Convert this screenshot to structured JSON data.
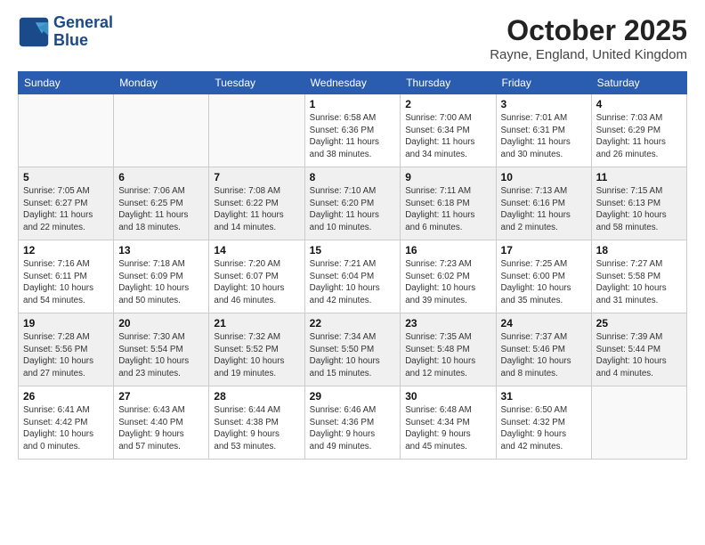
{
  "header": {
    "logo_line1": "General",
    "logo_line2": "Blue",
    "month": "October 2025",
    "location": "Rayne, England, United Kingdom"
  },
  "weekdays": [
    "Sunday",
    "Monday",
    "Tuesday",
    "Wednesday",
    "Thursday",
    "Friday",
    "Saturday"
  ],
  "weeks": [
    [
      {
        "day": "",
        "info": ""
      },
      {
        "day": "",
        "info": ""
      },
      {
        "day": "",
        "info": ""
      },
      {
        "day": "1",
        "info": "Sunrise: 6:58 AM\nSunset: 6:36 PM\nDaylight: 11 hours\nand 38 minutes."
      },
      {
        "day": "2",
        "info": "Sunrise: 7:00 AM\nSunset: 6:34 PM\nDaylight: 11 hours\nand 34 minutes."
      },
      {
        "day": "3",
        "info": "Sunrise: 7:01 AM\nSunset: 6:31 PM\nDaylight: 11 hours\nand 30 minutes."
      },
      {
        "day": "4",
        "info": "Sunrise: 7:03 AM\nSunset: 6:29 PM\nDaylight: 11 hours\nand 26 minutes."
      }
    ],
    [
      {
        "day": "5",
        "info": "Sunrise: 7:05 AM\nSunset: 6:27 PM\nDaylight: 11 hours\nand 22 minutes."
      },
      {
        "day": "6",
        "info": "Sunrise: 7:06 AM\nSunset: 6:25 PM\nDaylight: 11 hours\nand 18 minutes."
      },
      {
        "day": "7",
        "info": "Sunrise: 7:08 AM\nSunset: 6:22 PM\nDaylight: 11 hours\nand 14 minutes."
      },
      {
        "day": "8",
        "info": "Sunrise: 7:10 AM\nSunset: 6:20 PM\nDaylight: 11 hours\nand 10 minutes."
      },
      {
        "day": "9",
        "info": "Sunrise: 7:11 AM\nSunset: 6:18 PM\nDaylight: 11 hours\nand 6 minutes."
      },
      {
        "day": "10",
        "info": "Sunrise: 7:13 AM\nSunset: 6:16 PM\nDaylight: 11 hours\nand 2 minutes."
      },
      {
        "day": "11",
        "info": "Sunrise: 7:15 AM\nSunset: 6:13 PM\nDaylight: 10 hours\nand 58 minutes."
      }
    ],
    [
      {
        "day": "12",
        "info": "Sunrise: 7:16 AM\nSunset: 6:11 PM\nDaylight: 10 hours\nand 54 minutes."
      },
      {
        "day": "13",
        "info": "Sunrise: 7:18 AM\nSunset: 6:09 PM\nDaylight: 10 hours\nand 50 minutes."
      },
      {
        "day": "14",
        "info": "Sunrise: 7:20 AM\nSunset: 6:07 PM\nDaylight: 10 hours\nand 46 minutes."
      },
      {
        "day": "15",
        "info": "Sunrise: 7:21 AM\nSunset: 6:04 PM\nDaylight: 10 hours\nand 42 minutes."
      },
      {
        "day": "16",
        "info": "Sunrise: 7:23 AM\nSunset: 6:02 PM\nDaylight: 10 hours\nand 39 minutes."
      },
      {
        "day": "17",
        "info": "Sunrise: 7:25 AM\nSunset: 6:00 PM\nDaylight: 10 hours\nand 35 minutes."
      },
      {
        "day": "18",
        "info": "Sunrise: 7:27 AM\nSunset: 5:58 PM\nDaylight: 10 hours\nand 31 minutes."
      }
    ],
    [
      {
        "day": "19",
        "info": "Sunrise: 7:28 AM\nSunset: 5:56 PM\nDaylight: 10 hours\nand 27 minutes."
      },
      {
        "day": "20",
        "info": "Sunrise: 7:30 AM\nSunset: 5:54 PM\nDaylight: 10 hours\nand 23 minutes."
      },
      {
        "day": "21",
        "info": "Sunrise: 7:32 AM\nSunset: 5:52 PM\nDaylight: 10 hours\nand 19 minutes."
      },
      {
        "day": "22",
        "info": "Sunrise: 7:34 AM\nSunset: 5:50 PM\nDaylight: 10 hours\nand 15 minutes."
      },
      {
        "day": "23",
        "info": "Sunrise: 7:35 AM\nSunset: 5:48 PM\nDaylight: 10 hours\nand 12 minutes."
      },
      {
        "day": "24",
        "info": "Sunrise: 7:37 AM\nSunset: 5:46 PM\nDaylight: 10 hours\nand 8 minutes."
      },
      {
        "day": "25",
        "info": "Sunrise: 7:39 AM\nSunset: 5:44 PM\nDaylight: 10 hours\nand 4 minutes."
      }
    ],
    [
      {
        "day": "26",
        "info": "Sunrise: 6:41 AM\nSunset: 4:42 PM\nDaylight: 10 hours\nand 0 minutes."
      },
      {
        "day": "27",
        "info": "Sunrise: 6:43 AM\nSunset: 4:40 PM\nDaylight: 9 hours\nand 57 minutes."
      },
      {
        "day": "28",
        "info": "Sunrise: 6:44 AM\nSunset: 4:38 PM\nDaylight: 9 hours\nand 53 minutes."
      },
      {
        "day": "29",
        "info": "Sunrise: 6:46 AM\nSunset: 4:36 PM\nDaylight: 9 hours\nand 49 minutes."
      },
      {
        "day": "30",
        "info": "Sunrise: 6:48 AM\nSunset: 4:34 PM\nDaylight: 9 hours\nand 45 minutes."
      },
      {
        "day": "31",
        "info": "Sunrise: 6:50 AM\nSunset: 4:32 PM\nDaylight: 9 hours\nand 42 minutes."
      },
      {
        "day": "",
        "info": ""
      }
    ]
  ]
}
